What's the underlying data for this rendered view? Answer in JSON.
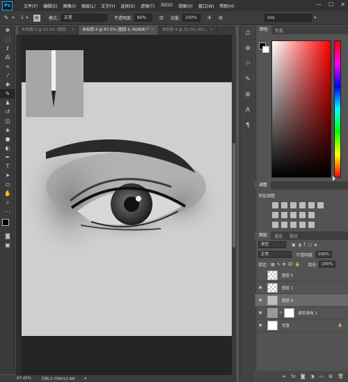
{
  "menubar": {
    "logo": "Ps",
    "items": [
      "文件(F)",
      "编辑(E)",
      "图像(I)",
      "图层(L)",
      "文字(Y)",
      "选择(S)",
      "滤镜(T)",
      "3D(D)",
      "视图(V)",
      "窗口(W)",
      "帮助(H)"
    ],
    "win_min": "—",
    "win_max": "☐",
    "win_close": "✕"
  },
  "options": {
    "brush_size": "1",
    "mode_label": "模式:",
    "mode_value": "正常",
    "opacity_label": "不透明度:",
    "opacity_value": "90%",
    "flow_label": "流量:",
    "flow_value": "100%",
    "search_value": "zzq"
  },
  "tabs": [
    {
      "label": "未标题-2 @ 33.3% (图层...",
      "active": false
    },
    {
      "label": "未标题-3 @ 67.5% (图层 6, RGB/8) *",
      "active": true
    },
    {
      "label": "未标题-4 @ 33.3% (RG...",
      "active": false
    }
  ],
  "status": {
    "zoom": "67.45%",
    "doc": "文档:3.75M/13.9M"
  },
  "color_panel": {
    "tab_color": "颜色",
    "tab_swatches": "色板",
    "fg": "#000000",
    "bg": "#ffffff",
    "picker_hue": "#ff0000"
  },
  "adjust_panel": {
    "tab": "调整",
    "add_label": "添加调整"
  },
  "layers_panel": {
    "tab_layers": "图层",
    "tab_channels": "通道",
    "tab_paths": "路径",
    "filter_kind": "类型",
    "blend_mode": "正常",
    "opacity_label": "不透明度:",
    "opacity_value": "100%",
    "lock_label": "锁定:",
    "fill_label": "填充:",
    "fill_value": "100%",
    "layers": [
      {
        "name": "图层 5",
        "visible": false,
        "selected": false
      },
      {
        "name": "图层 1",
        "visible": true,
        "selected": false
      },
      {
        "name": "图层 6",
        "visible": true,
        "selected": true
      },
      {
        "name": "颜色填充 1",
        "visible": true,
        "selected": false
      },
      {
        "name": "背景",
        "visible": true,
        "selected": false
      }
    ]
  }
}
